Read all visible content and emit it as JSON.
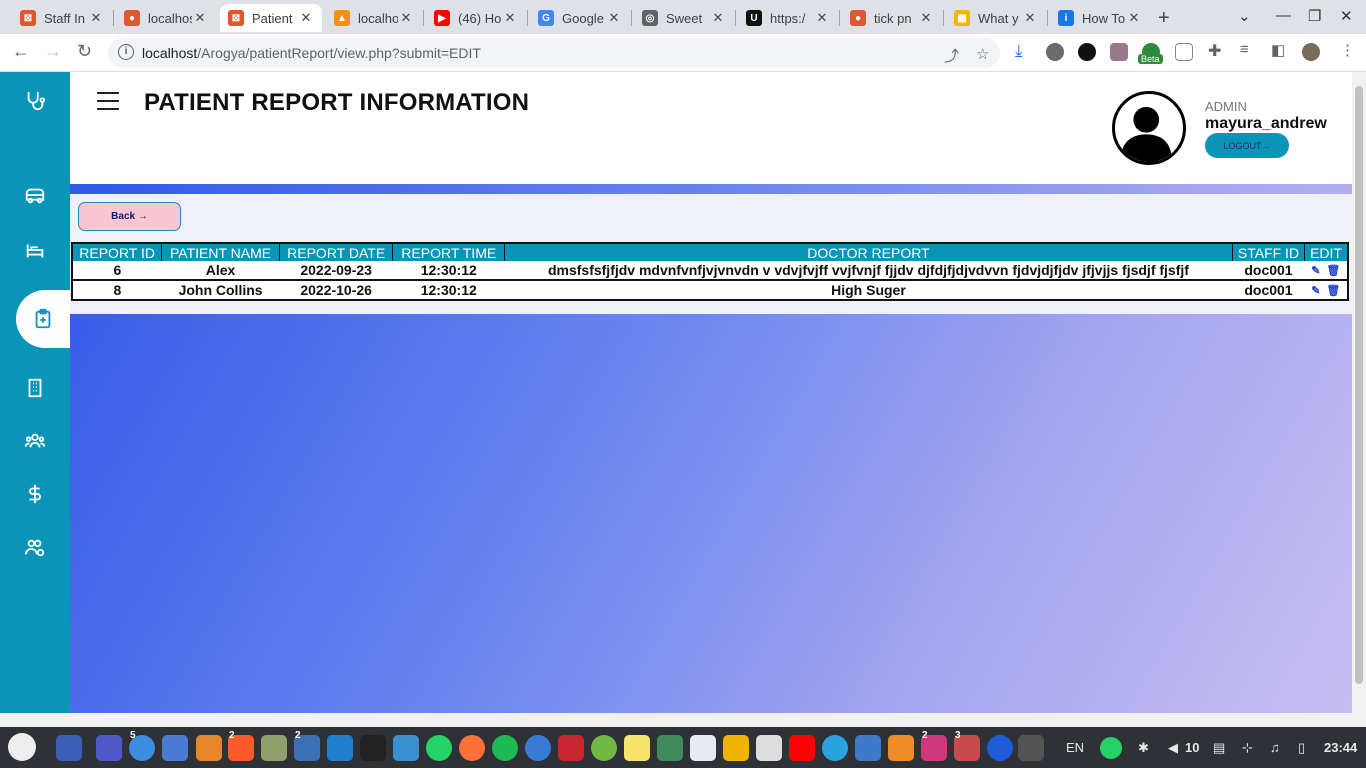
{
  "browser": {
    "tabs": [
      {
        "label": "Staff In",
        "icon": "xampp-icon",
        "color": "#e2562e"
      },
      {
        "label": "localhost",
        "icon": "duckduckgo-icon",
        "color": "#de5833"
      },
      {
        "label": "Patient",
        "icon": "xampp-icon",
        "color": "#e2562e",
        "active": true
      },
      {
        "label": "localhost",
        "icon": "phpmyadmin-icon",
        "color": "#f29111"
      },
      {
        "label": "(46) Ho",
        "icon": "youtube-icon",
        "color": "#ff0000"
      },
      {
        "label": "Google",
        "icon": "google-translate-icon",
        "color": "#4285f4"
      },
      {
        "label": "Sweet",
        "icon": "globe-icon",
        "color": "#5f6368"
      },
      {
        "label": "https:/",
        "icon": "u-icon",
        "color": "#111111"
      },
      {
        "label": "tick pn",
        "icon": "duckduckgo-icon",
        "color": "#de5833"
      },
      {
        "label": "What y",
        "icon": "grid-icon",
        "color": "#f4b400"
      },
      {
        "label": "How To",
        "icon": "info-icon",
        "color": "#1a73e8"
      }
    ],
    "url_host": "localhost",
    "url_path": "/Arogya/patientReport/view.php?submit=EDIT",
    "beta_label": "Beta"
  },
  "header": {
    "title": "PATIENT REPORT INFORMATION",
    "role": "ADMIN",
    "username": "mayura_andrew",
    "logout_label": "LOGOUT→"
  },
  "content": {
    "back_label": "Back →"
  },
  "table": {
    "columns": [
      "REPORT ID",
      "PATIENT NAME",
      "REPORT DATE",
      "REPORT TIME",
      "DOCTOR REPORT",
      "STAFF ID",
      "EDIT"
    ],
    "rows": [
      {
        "report_id": "6",
        "patient_name": "Alex",
        "report_date": "2022-09-23",
        "report_time": "12:30:12",
        "doctor_report": "dmsfsfsfjfjdv mdvnfvnfjvjvnvdn v vdvjfvjff vvjfvnjf fjjdv djfdjfjdjvdvvn fjdvjdjfjdv jfjvjjs fjsdjf fjsfjf",
        "staff_id": "doc001"
      },
      {
        "report_id": "8",
        "patient_name": "John Collins",
        "report_date": "2022-10-26",
        "report_time": "12:30:12",
        "doctor_report": "High Suger",
        "staff_id": "doc001"
      }
    ]
  },
  "sidebar": {
    "items": [
      {
        "name": "stethoscope-icon"
      },
      {
        "name": "ambulance-icon"
      },
      {
        "name": "bed-icon"
      },
      {
        "name": "clipboard-icon",
        "active": true
      },
      {
        "name": "building-icon"
      },
      {
        "name": "users-icon"
      },
      {
        "name": "dollar-icon"
      },
      {
        "name": "user-settings-icon"
      }
    ]
  },
  "taskbar": {
    "badges": [
      "5",
      "2",
      "2",
      "2",
      "3"
    ],
    "lang": "EN",
    "volume": "10",
    "time": "23:44"
  },
  "colors": {
    "accent": "#0a95b8",
    "gradient_start": "#2b53e8",
    "gradient_end": "#c7bdf2",
    "back_button": "#f7c5d4"
  }
}
